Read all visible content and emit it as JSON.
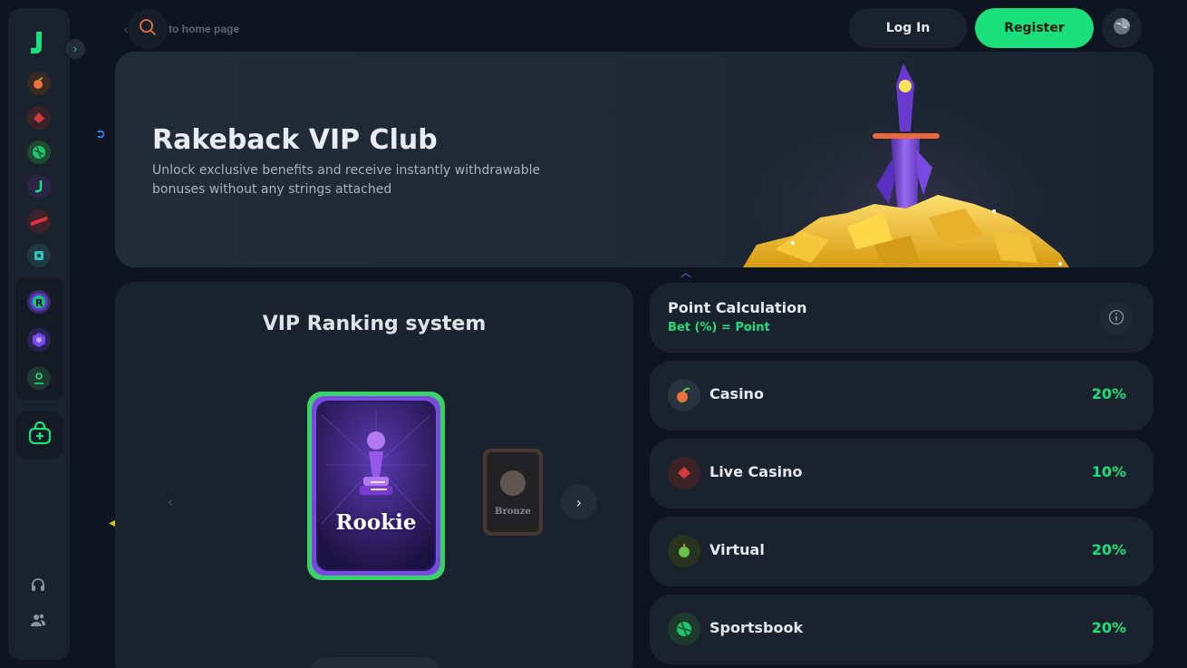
{
  "topbar": {
    "home_link": "to home page",
    "login_label": "Log In",
    "register_label": "Register"
  },
  "sidebar": {
    "items": [
      {
        "icon": "casino-icon"
      },
      {
        "icon": "live-casino-icon"
      },
      {
        "icon": "sportsbook-icon"
      },
      {
        "icon": "originals-icon"
      },
      {
        "icon": "virtual-sports-icon"
      },
      {
        "icon": "promotions-icon"
      },
      {
        "icon": "rakeback-icon"
      },
      {
        "icon": "vip-icon"
      },
      {
        "icon": "affiliate-icon"
      }
    ],
    "bonus_icon": "bonus-bag-icon",
    "support_icon": "headset-icon",
    "community_icon": "users-icon"
  },
  "hero": {
    "title": "Rakeback VIP Club",
    "subtitle": "Unlock exclusive benefits and receive instantly withdrawable bonuses without any strings attached"
  },
  "ranking": {
    "title": "VIP Ranking system",
    "current_rank": "Rookie",
    "next_rank": "Bronze"
  },
  "points": {
    "title": "Point Calculation",
    "formula": "Bet (%) = Point",
    "categories": [
      {
        "name": "Casino",
        "percent": "20%",
        "icon": "casino-icon"
      },
      {
        "name": "Live Casino",
        "percent": "10%",
        "icon": "live-casino-icon"
      },
      {
        "name": "Virtual",
        "percent": "20%",
        "icon": "virtual-icon"
      },
      {
        "name": "Sportsbook",
        "percent": "20%",
        "icon": "sportsbook-icon"
      }
    ]
  },
  "colors": {
    "accent": "#19e07a",
    "background": "#0e1520",
    "panel": "#1a222d"
  }
}
